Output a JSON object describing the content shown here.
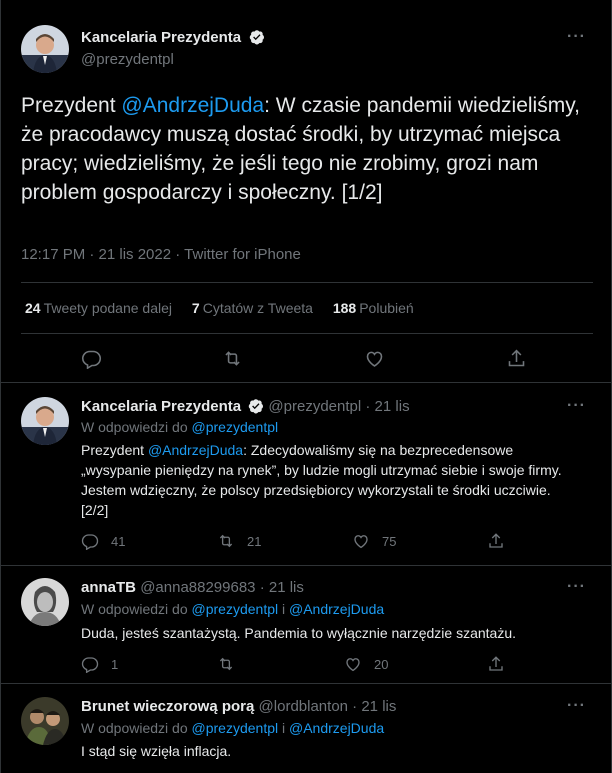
{
  "main_tweet": {
    "author_name": "Kancelaria Prezydenta",
    "author_handle": "@prezydentpl",
    "text_prefix": "Prezydent ",
    "text_mention": "@AndrzejDuda",
    "text_rest": ": W czasie pandemii wiedzieliśmy, że pracodawcy muszą dostać środki, by utrzymać miejsca pracy; wiedzieliśmy, że jeśli tego nie zrobimy, grozi nam problem gospodarczy i społeczny. [1/2]",
    "meta": "12:17 PM · 21 lis 2022 · Twitter for iPhone",
    "retweets_count": "24",
    "retweets_label": "Tweety podane dalej",
    "quotes_count": "7",
    "quotes_label": "Cytatów z Tweeta",
    "likes_count": "188",
    "likes_label": "Polubień"
  },
  "replies": [
    {
      "author_name": "Kancelaria Prezydenta",
      "author_handle": "@prezydentpl",
      "time": "21 lis",
      "reply_to_prefix": "W odpowiedzi do ",
      "reply_to_1": "@prezydentpl",
      "reply_to_joiner": "",
      "reply_to_2": "",
      "text_prefix": "Prezydent ",
      "text_mention": "@AndrzejDuda",
      "text_rest": ": Zdecydowaliśmy się na bezprecedensowe „wysypanie pieniędzy na rynek”, by ludzie mogli utrzymać siebie i swoje firmy. Jestem wdzięczny, że polscy przedsiębiorcy wykorzystali te środki uczciwie. [2/2]",
      "replies_count": "41",
      "retweets_count": "21",
      "likes_count": "75"
    },
    {
      "author_name": "annaTB",
      "author_handle": "@anna88299683",
      "time": "21 lis",
      "reply_to_prefix": "W odpowiedzi do ",
      "reply_to_1": "@prezydentpl",
      "reply_to_joiner": " i ",
      "reply_to_2": "@AndrzejDuda",
      "text": "Duda, jesteś szantażystą. Pandemia to wyłącznie narzędzie szantażu.",
      "replies_count": "1",
      "retweets_count": "",
      "likes_count": "20"
    },
    {
      "author_name": "Brunet wieczorową porą",
      "author_handle": "@lordblanton",
      "time": "21 lis",
      "reply_to_prefix": "W odpowiedzi do ",
      "reply_to_1": "@prezydentpl",
      "reply_to_joiner": " i ",
      "reply_to_2": "@AndrzejDuda",
      "text": "I stąd się wzięła inflacja."
    }
  ],
  "colors": {
    "accent": "#1d9bf0",
    "muted": "#71767b",
    "text": "#e7e9ea",
    "border": "#2f3336",
    "background": "#000000"
  },
  "icons": [
    "verified-badge-icon",
    "more-icon",
    "reply-icon",
    "retweet-icon",
    "like-icon",
    "share-icon"
  ]
}
